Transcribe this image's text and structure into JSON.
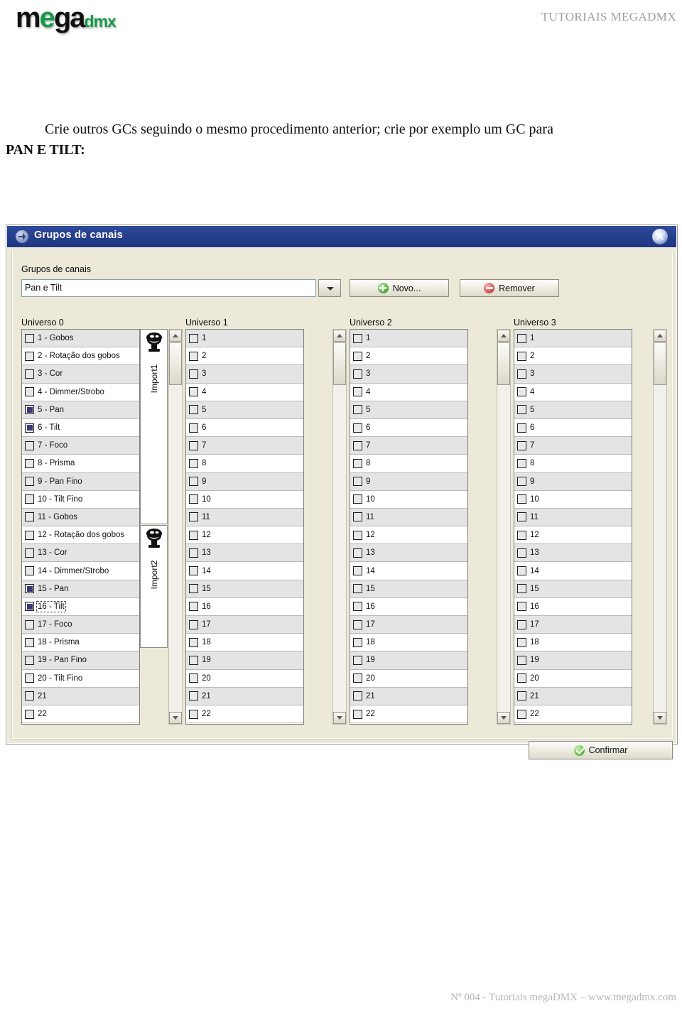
{
  "header": {
    "logo_mega": "mega",
    "logo_m": "m",
    "logo_e": "e",
    "logo_ga": "ga",
    "logo_dmx": "dmx",
    "right_title": "TUTORIAIS MEGADMX"
  },
  "body_text": {
    "paragraph": "Crie outros GCs seguindo o mesmo procedimento anterior; crie por exemplo um GC para",
    "bold_line": "PAN E TILT:"
  },
  "dialog": {
    "title": "Grupos de canais",
    "close_icon": "close-icon",
    "group_label": "Grupos de canais",
    "combo_value": "Pan e Tilt",
    "combo_arrow_icon": "chevron-down-icon",
    "buttons": {
      "novo": "Novo...",
      "novo_mnemonic": "N",
      "novo_icon": "plus-circle-icon",
      "remover": "Remover",
      "remover_mnemonic": "R",
      "remover_icon": "minus-circle-icon",
      "confirmar": "Confirmar",
      "confirmar_mnemonic": "o",
      "confirmar_icon": "check-circle-icon"
    },
    "columns": [
      {
        "header": "Universo 0",
        "items": [
          {
            "n": "1",
            "label": "1 - Gobos",
            "checked": false
          },
          {
            "n": "2",
            "label": "2 - Rotação dos gobos",
            "checked": false
          },
          {
            "n": "3",
            "label": "3 - Cor",
            "checked": false
          },
          {
            "n": "4",
            "label": "4 - Dimmer/Strobo",
            "checked": false
          },
          {
            "n": "5",
            "label": "5 - Pan",
            "checked": true
          },
          {
            "n": "6",
            "label": "6 - Tilt",
            "checked": true
          },
          {
            "n": "7",
            "label": "7 - Foco",
            "checked": false
          },
          {
            "n": "8",
            "label": "8 - Prisma",
            "checked": false
          },
          {
            "n": "9",
            "label": "9 - Pan Fino",
            "checked": false
          },
          {
            "n": "10",
            "label": "10 - Tilt Fino",
            "checked": false
          },
          {
            "n": "11",
            "label": "11 - Gobos",
            "checked": false
          },
          {
            "n": "12",
            "label": "12 - Rotação dos gobos",
            "checked": false
          },
          {
            "n": "13",
            "label": "13 - Cor",
            "checked": false
          },
          {
            "n": "14",
            "label": "14 - Dimmer/Strobo",
            "checked": false
          },
          {
            "n": "15",
            "label": "15 - Pan",
            "checked": true
          },
          {
            "n": "16",
            "label": "16 - Tilt",
            "checked": true,
            "focused": true
          },
          {
            "n": "17",
            "label": "17 - Foco",
            "checked": false
          },
          {
            "n": "18",
            "label": "18 - Prisma",
            "checked": false
          },
          {
            "n": "19",
            "label": "19 - Pan Fino",
            "checked": false
          },
          {
            "n": "20",
            "label": "20 - Tilt Fino",
            "checked": false
          },
          {
            "n": "21",
            "label": "21",
            "checked": false
          },
          {
            "n": "22",
            "label": "22",
            "checked": false
          }
        ],
        "fixtures": [
          {
            "label": "Import1",
            "icon": "moving-head-fixture-icon"
          },
          {
            "label": "Import2",
            "icon": "moving-head-fixture-icon"
          }
        ]
      },
      {
        "header": "Universo 1",
        "items": [
          {
            "n": "1",
            "label": "1",
            "checked": false
          },
          {
            "n": "2",
            "label": "2",
            "checked": false
          },
          {
            "n": "3",
            "label": "3",
            "checked": false
          },
          {
            "n": "4",
            "label": "4",
            "checked": false
          },
          {
            "n": "5",
            "label": "5",
            "checked": false
          },
          {
            "n": "6",
            "label": "6",
            "checked": false
          },
          {
            "n": "7",
            "label": "7",
            "checked": false
          },
          {
            "n": "8",
            "label": "8",
            "checked": false
          },
          {
            "n": "9",
            "label": "9",
            "checked": false
          },
          {
            "n": "10",
            "label": "10",
            "checked": false
          },
          {
            "n": "11",
            "label": "11",
            "checked": false
          },
          {
            "n": "12",
            "label": "12",
            "checked": false
          },
          {
            "n": "13",
            "label": "13",
            "checked": false
          },
          {
            "n": "14",
            "label": "14",
            "checked": false
          },
          {
            "n": "15",
            "label": "15",
            "checked": false
          },
          {
            "n": "16",
            "label": "16",
            "checked": false
          },
          {
            "n": "17",
            "label": "17",
            "checked": false
          },
          {
            "n": "18",
            "label": "18",
            "checked": false
          },
          {
            "n": "19",
            "label": "19",
            "checked": false
          },
          {
            "n": "20",
            "label": "20",
            "checked": false
          },
          {
            "n": "21",
            "label": "21",
            "checked": false
          },
          {
            "n": "22",
            "label": "22",
            "checked": false
          }
        ],
        "fixtures": []
      },
      {
        "header": "Universo 2",
        "items": [
          {
            "n": "1",
            "label": "1",
            "checked": false
          },
          {
            "n": "2",
            "label": "2",
            "checked": false
          },
          {
            "n": "3",
            "label": "3",
            "checked": false
          },
          {
            "n": "4",
            "label": "4",
            "checked": false
          },
          {
            "n": "5",
            "label": "5",
            "checked": false
          },
          {
            "n": "6",
            "label": "6",
            "checked": false
          },
          {
            "n": "7",
            "label": "7",
            "checked": false
          },
          {
            "n": "8",
            "label": "8",
            "checked": false
          },
          {
            "n": "9",
            "label": "9",
            "checked": false
          },
          {
            "n": "10",
            "label": "10",
            "checked": false
          },
          {
            "n": "11",
            "label": "11",
            "checked": false
          },
          {
            "n": "12",
            "label": "12",
            "checked": false
          },
          {
            "n": "13",
            "label": "13",
            "checked": false
          },
          {
            "n": "14",
            "label": "14",
            "checked": false
          },
          {
            "n": "15",
            "label": "15",
            "checked": false
          },
          {
            "n": "16",
            "label": "16",
            "checked": false
          },
          {
            "n": "17",
            "label": "17",
            "checked": false
          },
          {
            "n": "18",
            "label": "18",
            "checked": false
          },
          {
            "n": "19",
            "label": "19",
            "checked": false
          },
          {
            "n": "20",
            "label": "20",
            "checked": false
          },
          {
            "n": "21",
            "label": "21",
            "checked": false
          },
          {
            "n": "22",
            "label": "22",
            "checked": false
          }
        ],
        "fixtures": []
      },
      {
        "header": "Universo 3",
        "items": [
          {
            "n": "1",
            "label": "1",
            "checked": false
          },
          {
            "n": "2",
            "label": "2",
            "checked": false
          },
          {
            "n": "3",
            "label": "3",
            "checked": false
          },
          {
            "n": "4",
            "label": "4",
            "checked": false
          },
          {
            "n": "5",
            "label": "5",
            "checked": false
          },
          {
            "n": "6",
            "label": "6",
            "checked": false
          },
          {
            "n": "7",
            "label": "7",
            "checked": false
          },
          {
            "n": "8",
            "label": "8",
            "checked": false
          },
          {
            "n": "9",
            "label": "9",
            "checked": false
          },
          {
            "n": "10",
            "label": "10",
            "checked": false
          },
          {
            "n": "11",
            "label": "11",
            "checked": false
          },
          {
            "n": "12",
            "label": "12",
            "checked": false
          },
          {
            "n": "13",
            "label": "13",
            "checked": false
          },
          {
            "n": "14",
            "label": "14",
            "checked": false
          },
          {
            "n": "15",
            "label": "15",
            "checked": false
          },
          {
            "n": "16",
            "label": "16",
            "checked": false
          },
          {
            "n": "17",
            "label": "17",
            "checked": false
          },
          {
            "n": "18",
            "label": "18",
            "checked": false
          },
          {
            "n": "19",
            "label": "19",
            "checked": false
          },
          {
            "n": "20",
            "label": "20",
            "checked": false
          },
          {
            "n": "21",
            "label": "21",
            "checked": false
          },
          {
            "n": "22",
            "label": "22",
            "checked": false
          }
        ],
        "fixtures": []
      }
    ]
  },
  "footer": {
    "text": "Nº 004 - Tutoriais megaDMX – www.megadmx.com"
  },
  "colors": {
    "titlebar": "#27418f",
    "dialog_face": "#ece9d8",
    "accent_green": "#159a47",
    "row_alt": "#e4e4e4",
    "checkbox_fill": "#3a3a76"
  }
}
